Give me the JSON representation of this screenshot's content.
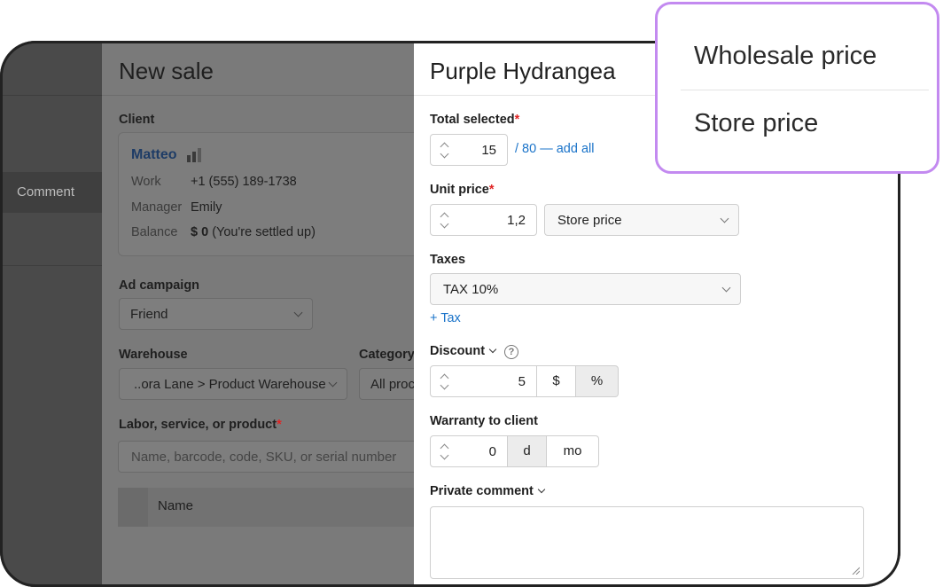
{
  "sidebar": {
    "comment_label": "Comment"
  },
  "main": {
    "title": "New sale",
    "client_label": "Client",
    "client": {
      "name": "Matteo",
      "rows": [
        {
          "key": "Work",
          "value": "+1 (555) 189-1738"
        },
        {
          "key": "Manager",
          "value": "Emily"
        },
        {
          "key": "Balance",
          "value_bold": "$ 0",
          "value_rest": " (You're settled up)"
        }
      ]
    },
    "ad_campaign_label": "Ad campaign",
    "ad_campaign_value": "Friend",
    "warehouse_label": "Warehouse",
    "warehouse_value": "..ora Lane > Product Warehouse",
    "category_label": "Category",
    "category_value": "All proc",
    "product_label": "Labor, service, or product",
    "product_placeholder": "Name, barcode, code, SKU, or serial number",
    "table_col_name": "Name"
  },
  "panel": {
    "title": "Purple Hydrangea",
    "total_selected_label": "Total selected",
    "total_selected_value": "15",
    "total_selected_link": "/ 80 — add all",
    "unit_price_label": "Unit price",
    "unit_price_value": "1,2",
    "price_type_value": "Store price",
    "taxes_label": "Taxes",
    "tax_value": "TAX 10%",
    "add_tax_link": "+ Tax",
    "discount_label": "Discount",
    "help_glyph": "?",
    "discount_value": "5",
    "discount_units": [
      "$",
      "%"
    ],
    "warranty_label": "Warranty to client",
    "warranty_value": "0",
    "warranty_units": [
      "d",
      "mo"
    ],
    "private_comment_label": "Private comment"
  },
  "popup": {
    "options": [
      "Wholesale price",
      "Store price"
    ]
  },
  "colors": {
    "accent": "#1a73c9",
    "popup_border": "#c38af0",
    "required": "#e02424"
  }
}
